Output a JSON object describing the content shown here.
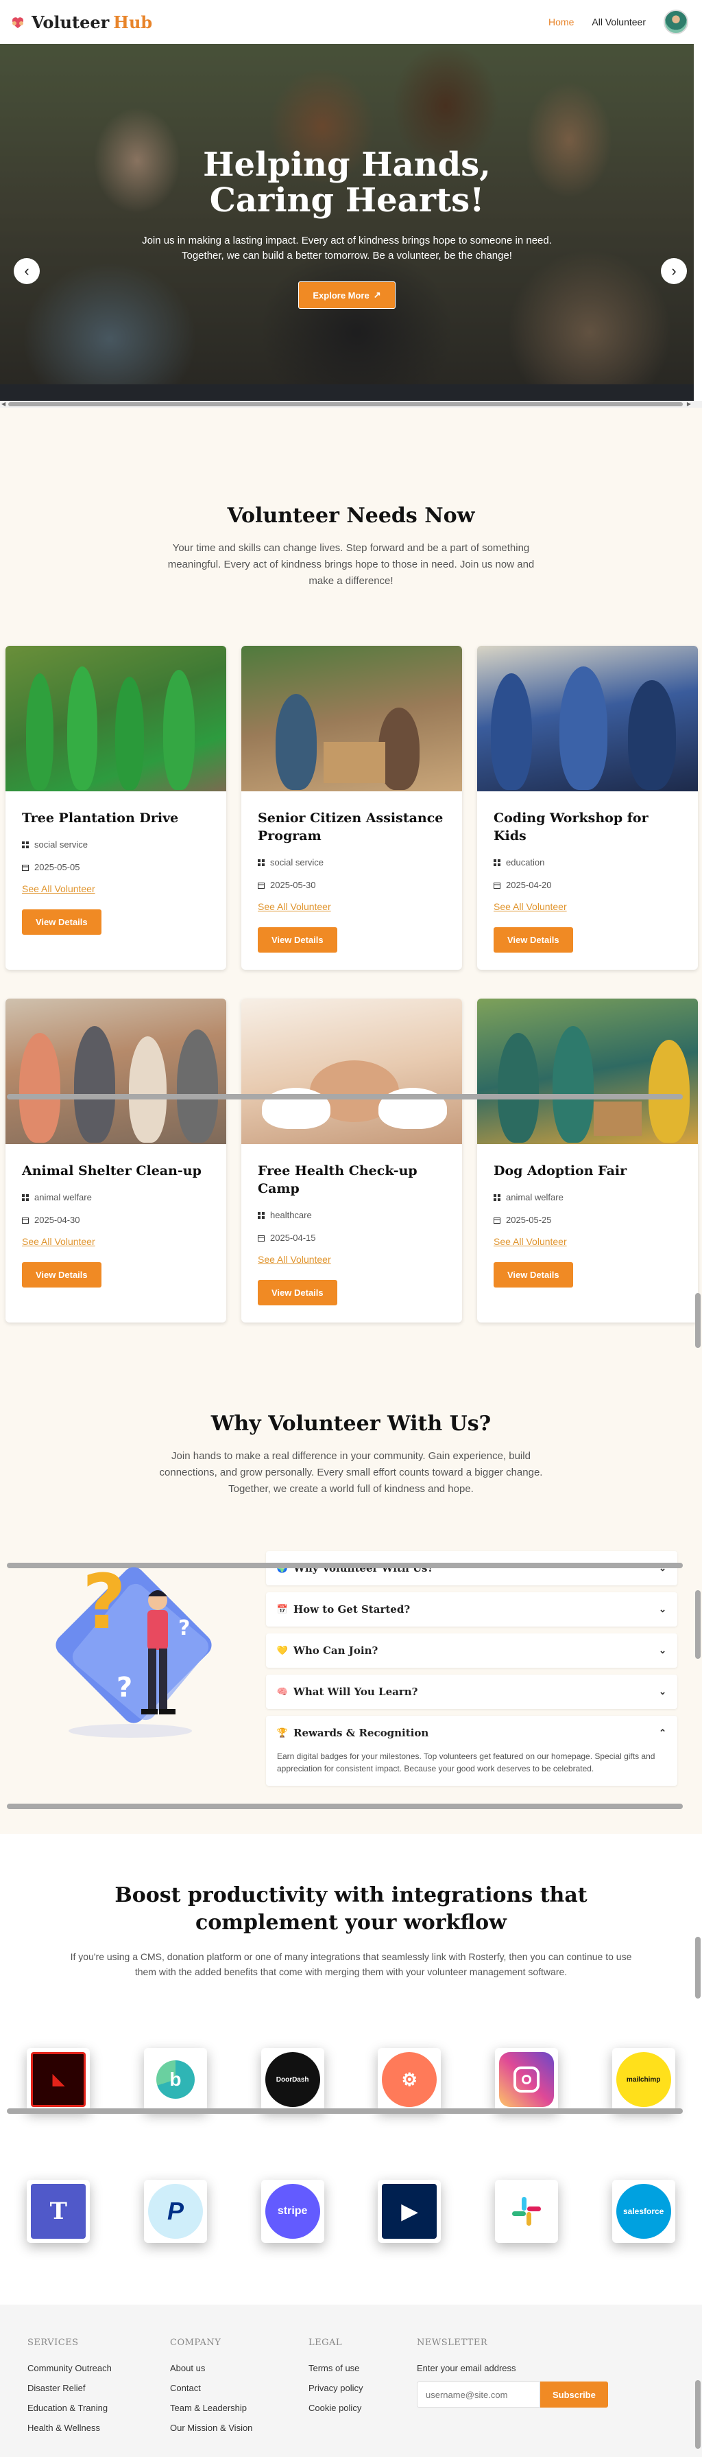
{
  "brand": {
    "part1": "Voluteer",
    "part2": "Hub"
  },
  "nav": {
    "home": "Home",
    "all": "All Volunteer"
  },
  "hero": {
    "title": "Helping Hands, Caring Hearts!",
    "subtitle": "Join us in making a lasting impact. Every act of kindness brings hope to someone in need. Together, we can build a better tomorrow. Be a volunteer, be the change!",
    "cta": "Explore More",
    "prev": "‹",
    "next": "›"
  },
  "needs": {
    "title": "Volunteer Needs Now",
    "subtitle": "Your time and skills can change lives. Step forward and be a part of something meaningful. Every act of kindness brings hope to those in need. Join us now and make a difference!",
    "see_all": "See All Volunteer",
    "details": "View Details",
    "cards": [
      {
        "title": "Tree Plantation Drive",
        "category": "social service",
        "date": "2025-05-05"
      },
      {
        "title": "Senior Citizen Assistance Program",
        "category": "social service",
        "date": "2025-05-30"
      },
      {
        "title": "Coding Workshop for Kids",
        "category": "education",
        "date": "2025-04-20"
      },
      {
        "title": "Animal Shelter Clean-up",
        "category": "animal welfare",
        "date": "2025-04-30"
      },
      {
        "title": "Free Health Check-up Camp",
        "category": "healthcare",
        "date": "2025-04-15"
      },
      {
        "title": "Dog Adoption Fair",
        "category": "animal welfare",
        "date": "2025-05-25"
      }
    ]
  },
  "why": {
    "title": "Why Volunteer With Us?",
    "subtitle": "Join hands to make a real difference in your community. Gain experience, build connections, and grow personally. Every small effort counts toward a bigger change. Together, we create a world full of kindness and hope.",
    "faq": [
      {
        "icon": "globe-icon",
        "q": "Why Volunteer With Us?"
      },
      {
        "icon": "calendar-icon",
        "q": "How to Get Started?"
      },
      {
        "icon": "heart-icon",
        "q": "Who Can Join?"
      },
      {
        "icon": "brain-icon",
        "q": "What Will You Learn?"
      },
      {
        "icon": "trophy-icon",
        "q": "Rewards & Recognition",
        "a": "Earn digital badges for your milestones. Top volunteers get featured on our homepage. Special gifts and appreciation for consistent impact. Because your good work deserves to be celebrated."
      }
    ]
  },
  "integrations": {
    "title": "Boost productivity with integrations that complement your workflow",
    "subtitle": "If you're using a CMS, donation platform or one of many integrations that seamlessly link with Rosterfy, then you can continue to use them with the added benefits that come with merging them with your volunteer management software.",
    "logos": [
      {
        "name": "Adobe",
        "color": "#e2231a"
      },
      {
        "name": "b",
        "color": "#2fb5b5"
      },
      {
        "name": "DoorDash",
        "color": "#111111"
      },
      {
        "name": "HubSpot",
        "color": "#ff7a59"
      },
      {
        "name": "Instagram",
        "color": "#d6249f"
      },
      {
        "name": "mailchimp",
        "color": "#ffe01b"
      },
      {
        "name": "Teams",
        "color": "#5059c9"
      },
      {
        "name": "PayPal",
        "color": "#009cde"
      },
      {
        "name": "stripe",
        "color": "#635bff"
      },
      {
        "name": "Dynamics",
        "color": "#002050"
      },
      {
        "name": "Slack",
        "color": "#ffffff"
      },
      {
        "name": "salesforce",
        "color": "#00a1e0"
      }
    ]
  },
  "footer": {
    "services": {
      "title": "SERVICES",
      "links": [
        "Community Outreach",
        "Disaster Relief",
        "Education & Traning",
        "Health & Wellness"
      ]
    },
    "company": {
      "title": "COMPANY",
      "links": [
        "About us",
        "Contact",
        "Team & Leadership",
        "Our Mission & Vision"
      ]
    },
    "legal": {
      "title": "LEGAL",
      "links": [
        "Terms of use",
        "Privacy policy",
        "Cookie policy"
      ]
    },
    "newsletter": {
      "title": "NEWSLETTER",
      "label": "Enter your email address",
      "placeholder": "username@site.com",
      "button": "Subscribe"
    }
  },
  "colors": {
    "accent": "#f08a24",
    "cream": "#fcf8f1"
  }
}
